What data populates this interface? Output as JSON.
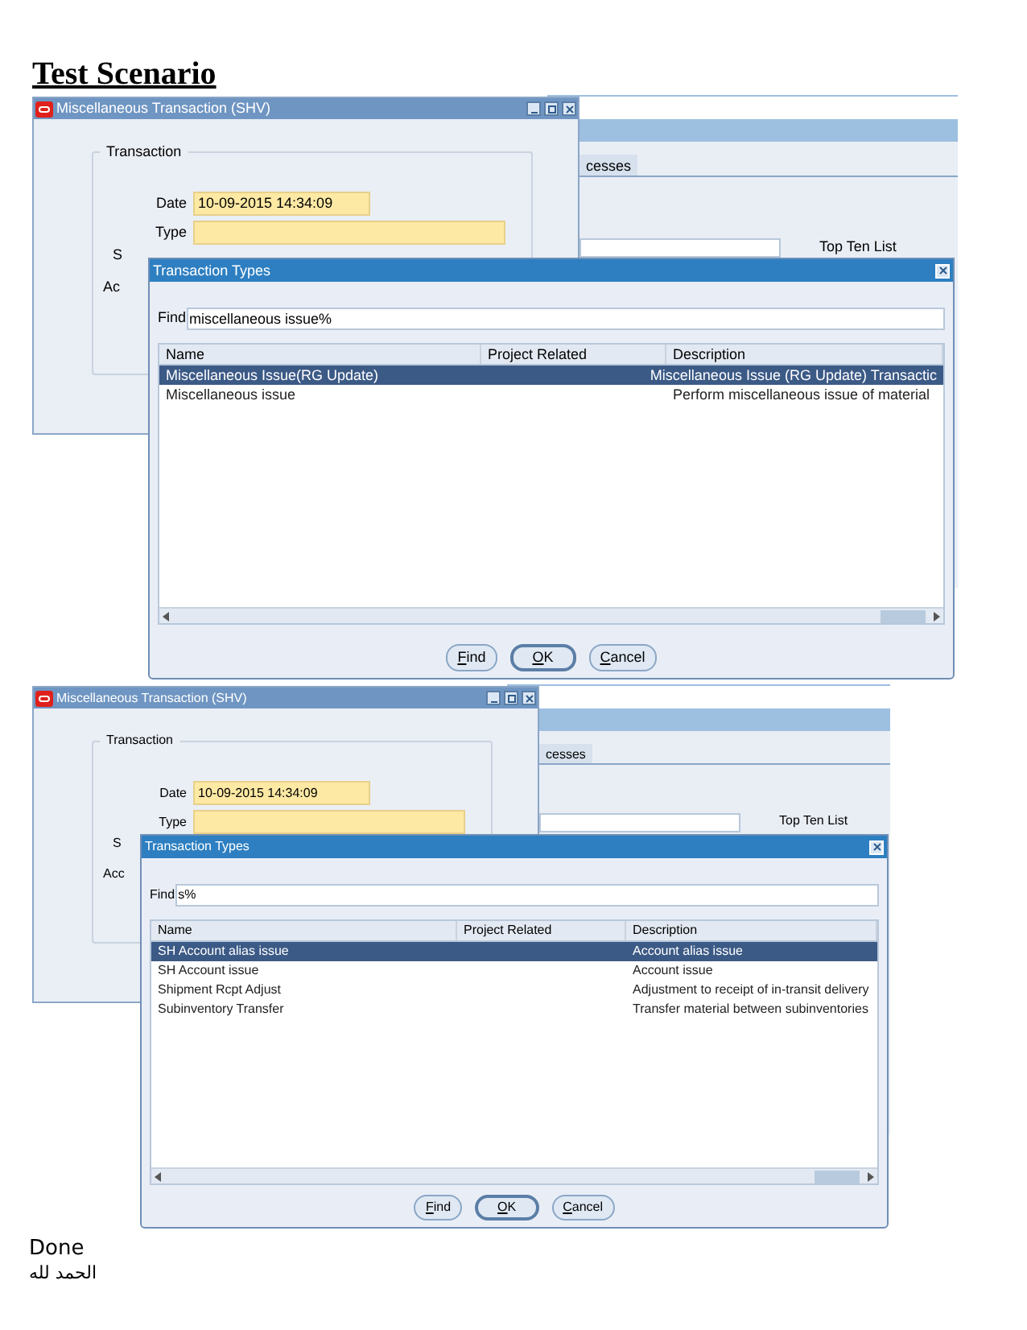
{
  "heading": "Test Scenario",
  "screenshots": [
    {
      "main_window": {
        "title": "Miscellaneous Transaction (SHV)",
        "group_label": "Transaction",
        "fields": [
          {
            "label": "Date",
            "value": "10-09-2015 14:34:09"
          },
          {
            "label": "Type"
          }
        ],
        "partial_labels": [
          "S",
          "Ac"
        ]
      },
      "background": {
        "tab": "cesses",
        "list_label": "Top Ten List"
      },
      "dialog": {
        "title": "Transaction Types",
        "find_label": "Find",
        "find_value": "miscellaneous issue%",
        "columns": [
          "Name",
          "Project Related",
          "Description"
        ],
        "rows": [
          {
            "name": "Miscellaneous Issue(RG Update)",
            "description": "Miscellaneous Issue (RG Update) Transactic",
            "selected": true
          },
          {
            "name": "Miscellaneous issue",
            "description": "Perform miscellaneous issue of material",
            "selected": false
          }
        ],
        "buttons": [
          {
            "label": "Find",
            "default": false
          },
          {
            "label": "OK",
            "default": true
          },
          {
            "label": "Cancel",
            "default": false
          }
        ]
      }
    },
    {
      "main_window": {
        "title": "Miscellaneous Transaction (SHV)",
        "group_label": "Transaction",
        "fields": [
          {
            "label": "Date",
            "value": "10-09-2015 14:34:09"
          },
          {
            "label": "Type"
          }
        ],
        "partial_labels": [
          "S",
          "Acc"
        ]
      },
      "background": {
        "tab": "cesses",
        "list_label": "Top Ten List"
      },
      "dialog": {
        "title": "Transaction Types",
        "find_label": "Find",
        "find_value": "s%",
        "columns": [
          "Name",
          "Project Related",
          "Description"
        ],
        "rows": [
          {
            "name": "SH Account alias issue",
            "description": "Account alias issue",
            "selected": true
          },
          {
            "name": "SH Account issue",
            "description": "Account issue",
            "selected": false
          },
          {
            "name": "Shipment Rcpt Adjust",
            "description": "Adjustment to receipt of in-transit delivery",
            "selected": false
          },
          {
            "name": "Subinventory Transfer",
            "description": "Transfer material between subinventories",
            "selected": false
          }
        ],
        "buttons": [
          {
            "label": "Find",
            "default": false
          },
          {
            "label": "OK",
            "default": true
          },
          {
            "label": "Cancel",
            "default": false
          }
        ]
      }
    }
  ],
  "footer": [
    "Done",
    "الحمد لله"
  ]
}
